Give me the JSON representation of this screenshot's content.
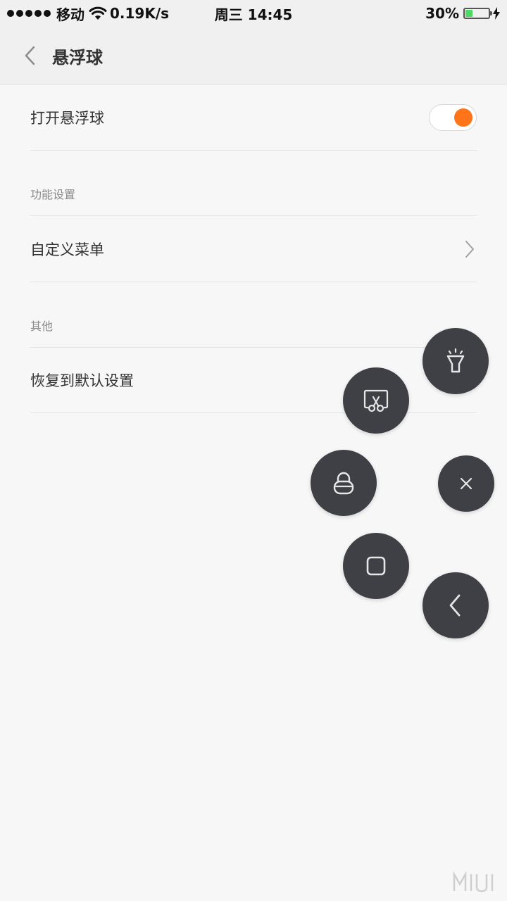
{
  "status_bar": {
    "carrier": "移动",
    "speed": "0.19K/s",
    "time": "周三 14:45",
    "battery": "30%",
    "battery_level": 0.3
  },
  "title_bar": {
    "title": "悬浮球"
  },
  "settings": {
    "toggle_label": "打开悬浮球",
    "toggle_on": true,
    "section_function": "功能设置",
    "custom_menu_label": "自定义菜单",
    "section_other": "其他",
    "restore_label": "恢复到默认设置"
  },
  "floating_menu": {
    "buttons": [
      {
        "name": "flashlight",
        "icon": "flashlight-icon"
      },
      {
        "name": "screenshot",
        "icon": "screenshot-scissors-icon"
      },
      {
        "name": "lock-screen",
        "icon": "lock-icon"
      },
      {
        "name": "close",
        "icon": "close-icon"
      },
      {
        "name": "home",
        "icon": "square-icon"
      },
      {
        "name": "back",
        "icon": "back-arrow-icon"
      }
    ]
  },
  "colors": {
    "accent": "#ff7418",
    "fab_background": "#3f4045",
    "battery_fill": "#4cd964"
  },
  "watermark": "MIUI"
}
